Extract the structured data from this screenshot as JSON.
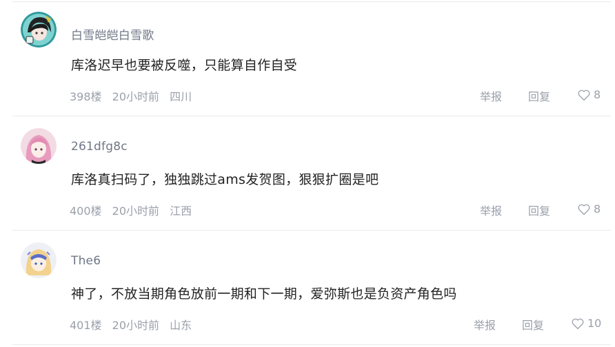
{
  "comments": [
    {
      "username": "白雪皑皑白雪歌",
      "content": "库洛迟早也要被反噬，只能算自作自受",
      "floor": "398楼",
      "time": "20小时前",
      "location": "四川",
      "report_label": "举报",
      "reply_label": "回复",
      "likes": "8",
      "avatar_icon": "anime-character-dark-hair-avatar"
    },
    {
      "username": "261dfg8c",
      "content": "库洛真扫码了，独独跳过ams发贺图，狠狠扩圈是吧",
      "floor": "400楼",
      "time": "20小时前",
      "location": "江西",
      "report_label": "举报",
      "reply_label": "回复",
      "likes": "8",
      "avatar_icon": "anime-character-pink-hair-avatar"
    },
    {
      "username": "The6",
      "content": "神了，不放当期角色放前一期和下一期，爱弥斯也是负资产角色吗",
      "floor": "401楼",
      "time": "20小时前",
      "location": "山东",
      "report_label": "举报",
      "reply_label": "回复",
      "likes": "10",
      "avatar_icon": "anime-character-blonde-hair-avatar"
    }
  ],
  "colors": {
    "text_primary": "#222222",
    "text_secondary": "#9aa0aa",
    "username": "#6f7785",
    "divider": "#ececec"
  }
}
